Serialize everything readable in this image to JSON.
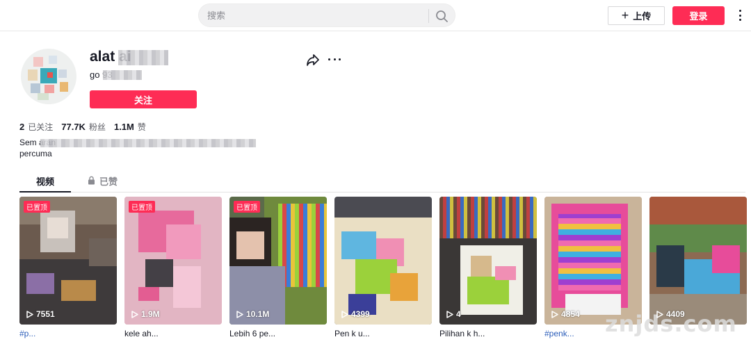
{
  "topbar": {
    "search_placeholder": "搜索",
    "upload_label": "上传",
    "login_label": "登录"
  },
  "profile": {
    "username": "alat ai",
    "nickname": "go 93",
    "follow_label": "关注",
    "stats": [
      {
        "value": "2",
        "label": "已关注"
      },
      {
        "value": "77.7K",
        "label": "粉丝"
      },
      {
        "value": "1.1M",
        "label": "赞"
      }
    ],
    "bio_line1": "Sem aran",
    "bio_line2": "percuma"
  },
  "tabs": {
    "videos": "视频",
    "liked": "已赞"
  },
  "videos": [
    {
      "pinned": "已置顶",
      "views": "7551",
      "caption": "#p..."
    },
    {
      "pinned": "已置顶",
      "views": "1.9M",
      "caption": "kele ah..."
    },
    {
      "pinned": "已置顶",
      "views": "10.1M",
      "caption": "Lebih 6 pe..."
    },
    {
      "pinned": "",
      "views": "4399",
      "caption": "Pen k u..."
    },
    {
      "pinned": "",
      "views": "4",
      "caption": "Pilihan k h..."
    },
    {
      "pinned": "",
      "views": "4854",
      "caption": "#penk..."
    },
    {
      "pinned": "",
      "views": "4409",
      "caption": ""
    }
  ],
  "watermark": "znjds.com",
  "colors": {
    "brand": "#fe2c55",
    "text": "#161823",
    "muted": "#8a8b91",
    "hashtag": "#2b5db9"
  }
}
